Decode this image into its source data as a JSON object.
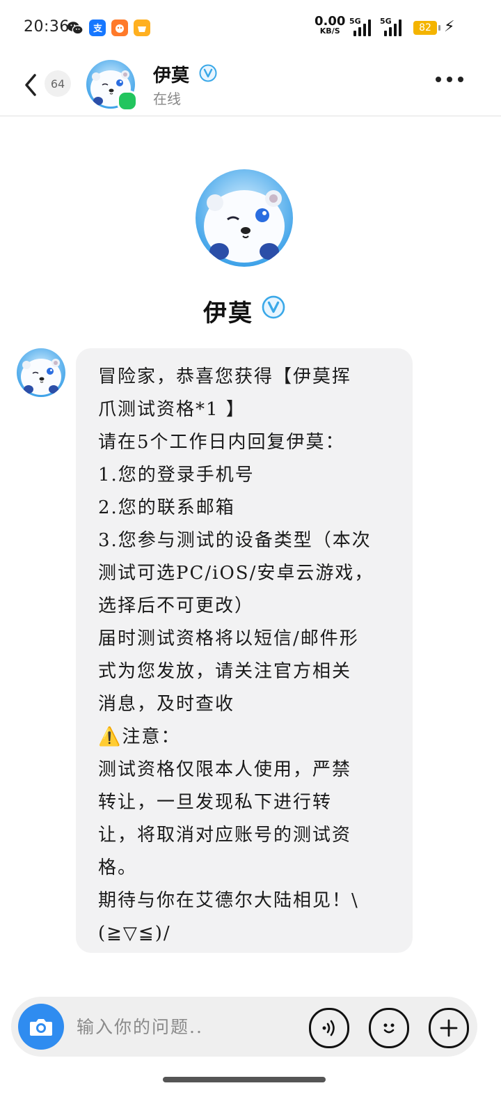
{
  "status_bar": {
    "time": "20:36",
    "net_speed_value": "0.00",
    "net_speed_unit": "KB/S",
    "sim1_label": "5G",
    "sim2_label": "5G",
    "battery": "82",
    "app_icons": [
      "wechat-icon",
      "alipay-icon",
      "taobao-icon",
      "meituan-icon"
    ]
  },
  "header": {
    "unread_count": "64",
    "name": "伊莫",
    "status": "在线"
  },
  "profile": {
    "name": "伊莫"
  },
  "message": {
    "lines": [
      "冒险家，恭喜您获得【伊莫挥",
      "爪测试资格*1 】",
      "请在5个工作日内回复伊莫：",
      "1.您的登录手机号",
      "2.您的联系邮箱",
      "3.您参与测试的设备类型（本次",
      "测试可选PC/iOS/安卓云游戏，",
      "选择后不可更改）",
      "届时测试资格将以短信/邮件形",
      "式为您发放，请关注官方相关",
      "消息，及时查收",
      "⚠️注意：",
      "测试资格仅限本人使用，严禁",
      "转让，一旦发现私下进行转",
      "让，将取消对应账号的测试资",
      "格。",
      "期待与你在艾德尔大陆相见！\\",
      "(≧▽≦)/"
    ]
  },
  "input": {
    "placeholder": "输入你的问题.."
  },
  "colors": {
    "accent": "#2f8cf0",
    "online": "#22c55e",
    "bubble": "#f2f2f3",
    "battery": "#f4b400"
  }
}
